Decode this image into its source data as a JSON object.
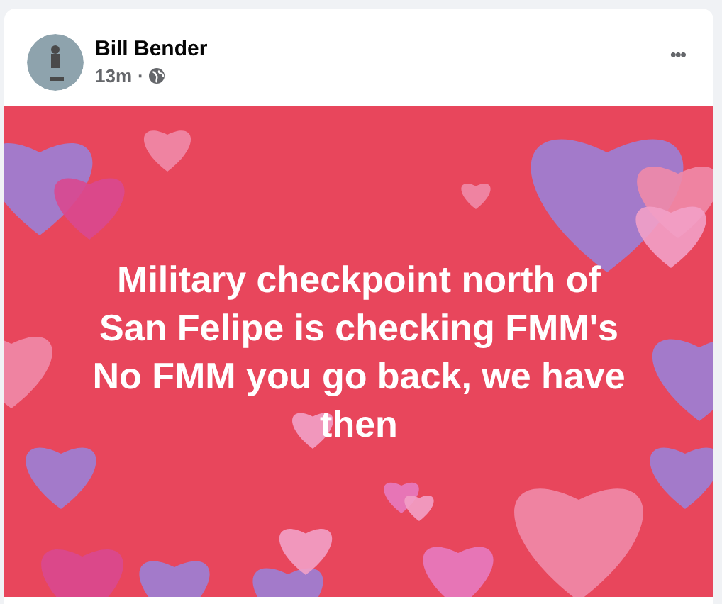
{
  "post": {
    "author": "Bill Bender",
    "time": "13m",
    "separator": "·",
    "menu": "•••",
    "text": "Military checkpoint north of San Felipe is checking FMM's No FMM you go back, we have then"
  }
}
